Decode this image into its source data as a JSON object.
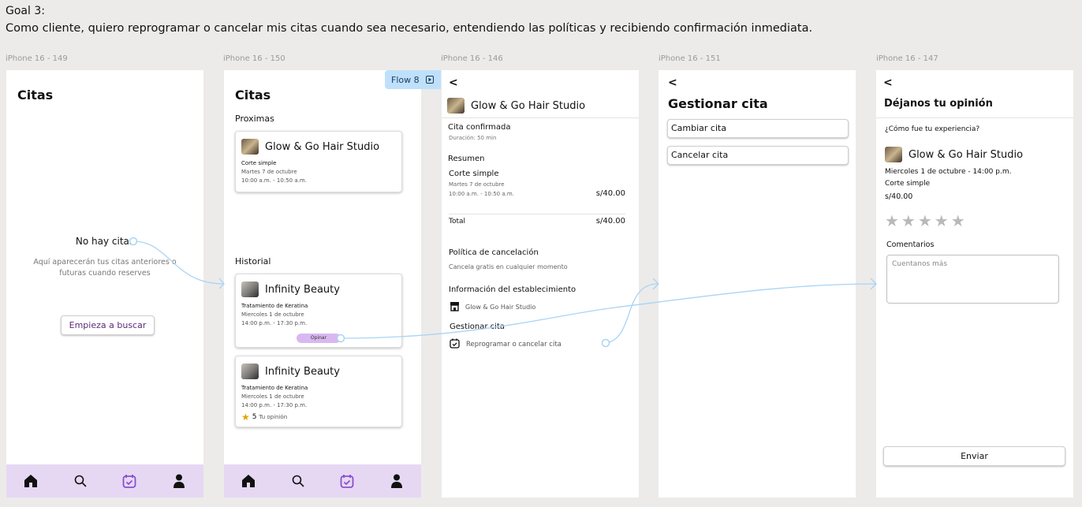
{
  "goal": {
    "title": "Goal 3:",
    "description": "Como cliente, quiero reprogramar o cancelar mis citas cuando sea necesario, entendiendo las políticas y recibiendo confirmación inmediata."
  },
  "frames": {
    "f1": {
      "label": "iPhone 16 - 149",
      "title": "Citas",
      "empty_title": "No hay citas",
      "empty_desc": "Aquí aparecerán tus citas anteriores o futuras cuando reserves",
      "cta": "Empieza a buscar"
    },
    "f2": {
      "label": "iPhone 16 - 150",
      "flow_badge": "Flow 8",
      "title": "Citas",
      "upcoming_heading": "Proximas",
      "upcoming": {
        "business": "Glow & Go Hair Studio",
        "service": "Corte simple",
        "date": "Martes 7 de octubre",
        "time": "10:00 a.m. - 10:50 a.m."
      },
      "history_heading": "Historial",
      "history": [
        {
          "business": "Infinity Beauty",
          "service": "Tratamiento de Keratina",
          "date": "Miercoles 1 de octubre",
          "time": "14:00 p.m. - 17:30 p.m.",
          "action": "Opinar"
        },
        {
          "business": "Infinity Beauty",
          "service": "Tratamiento de Keratina",
          "date": "Miercoles 1 de octubre",
          "time": "14:00 p.m. - 17:30 p.m.",
          "rating": "5",
          "rating_label": "Tu opinión"
        }
      ]
    },
    "f3": {
      "label": "iPhone 16 - 146",
      "back": "<",
      "business": "Glow & Go Hair Studio",
      "status": "Cita confirmada",
      "duration": "Duración: 50 min",
      "summary_heading": "Resumen",
      "service": "Corte simple",
      "date": "Martes 7 de octubre",
      "time": "10:00 a.m. - 10:50 a.m.",
      "price": "s/40.00",
      "total_label": "Total",
      "total_value": "s/40.00",
      "policy_heading": "Política de cancelación",
      "policy_text": "Cancela gratis en cualquier momento",
      "info_heading": "Información del establecimiento",
      "info_text": "Glow & Go Hair Studio",
      "manage_heading": "Gestionar cita",
      "manage_link": "Reprogramar o cancelar cita"
    },
    "f4": {
      "label": "iPhone 16 - 151",
      "back": "<",
      "title": "Gestionar cita",
      "change": "Cambiar cita",
      "cancel": "Cancelar cita"
    },
    "f5": {
      "label": "iPhone 16 - 147",
      "back": "<",
      "title": "Déjanos tu opinión",
      "question": "¿Cómo fue tu experiencia?",
      "business": "Glow & Go Hair Studio",
      "date": "Miercoles 1 de octubre - 14:00 p.m.",
      "service": "Corte simple",
      "price": "s/40.00",
      "stars": "★★★★★",
      "comments_label": "Comentarios",
      "comments_placeholder": "Cuentanos más",
      "submit": "Enviar"
    }
  },
  "colors": {
    "tabbar": "#e6d8f3",
    "accent": "#8a4fd0",
    "arrow": "#a9d4f5",
    "opinar": "#d9b8f0"
  }
}
